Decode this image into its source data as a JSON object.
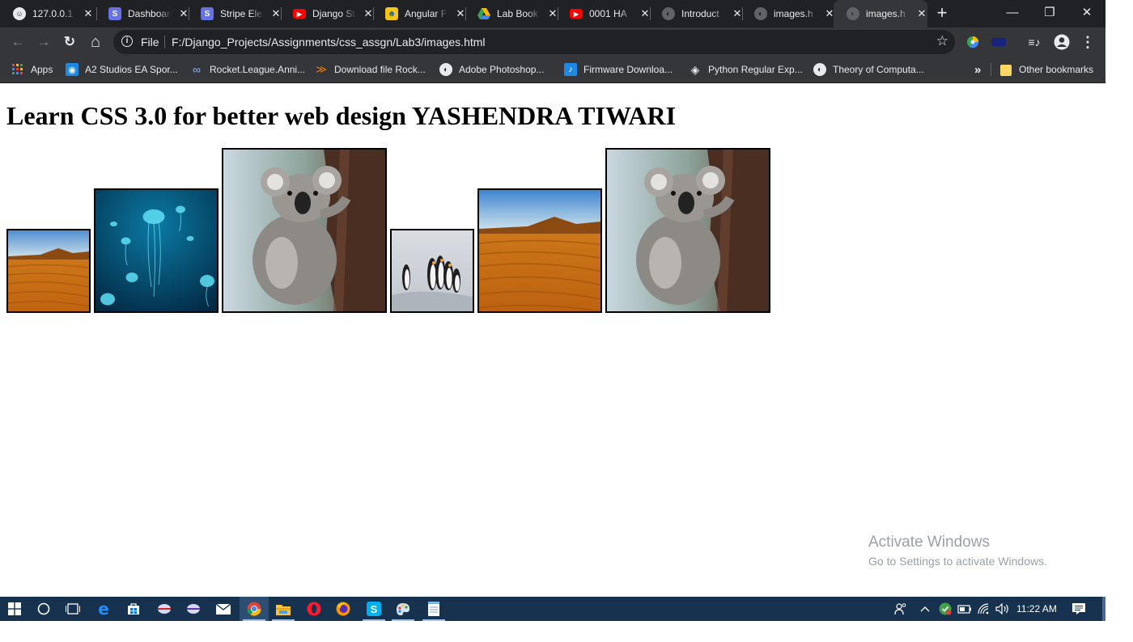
{
  "browser": {
    "tabs": [
      {
        "title": "127.0.0.1",
        "icon": "django-icon",
        "active": false
      },
      {
        "title": "Dashboard",
        "icon": "stripe-icon",
        "active": false
      },
      {
        "title": "Stripe Ele",
        "icon": "stripe-icon",
        "active": false
      },
      {
        "title": "Django St",
        "icon": "youtube-icon",
        "active": false
      },
      {
        "title": "Angular F",
        "icon": "python-icon",
        "active": false
      },
      {
        "title": "Lab Book",
        "icon": "google-drive-icon",
        "active": false
      },
      {
        "title": "0001 HA",
        "icon": "youtube-icon",
        "active": false
      },
      {
        "title": "Introduct",
        "icon": "globe-icon",
        "active": false
      },
      {
        "title": "images.h",
        "icon": "globe-icon",
        "active": false
      },
      {
        "title": "images.h",
        "icon": "globe-icon",
        "active": true
      }
    ],
    "new_tab_label": "+",
    "window_controls": {
      "minimize": "—",
      "restore": "❐",
      "close": "✕"
    },
    "toolbar": {
      "back": "←",
      "forward": "→",
      "reload": "↻",
      "home": "⌂",
      "scheme_label": "File",
      "info_glyph": "i",
      "url": "F:/Django_Projects/Assignments/css_assgn/Lab3/images.html",
      "bookmark_star": "☆"
    },
    "bookmarks": [
      {
        "label": "Apps",
        "icon": "apps-grid-icon"
      },
      {
        "label": "A2 Studios EA Spor...",
        "icon": "a2-studios-icon"
      },
      {
        "label": "Rocket.League.Anni...",
        "icon": "link-icon"
      },
      {
        "label": "Download file Rock...",
        "icon": "download-icon"
      },
      {
        "label": "Adobe Photoshop...",
        "icon": "globe-icon"
      },
      {
        "label": "Firmware Downloa...",
        "icon": "firmware-icon"
      },
      {
        "label": "Python Regular Exp...",
        "icon": "python-regex-icon"
      },
      {
        "label": "Theory of Computa...",
        "icon": "globe-icon"
      }
    ],
    "bookmarks_overflow": "»",
    "other_bookmarks": "Other bookmarks"
  },
  "page": {
    "heading": "Learn CSS 3.0 for better web design YASHENDRA TIWARI",
    "images": [
      {
        "subject": "desert"
      },
      {
        "subject": "jellyfish"
      },
      {
        "subject": "koala"
      },
      {
        "subject": "penguins"
      },
      {
        "subject": "desert"
      },
      {
        "subject": "koala"
      }
    ]
  },
  "watermark": {
    "title": "Activate Windows",
    "subtitle": "Go to Settings to activate Windows."
  },
  "taskbar": {
    "apps": [
      "start",
      "cortana",
      "task-view",
      "edge",
      "store",
      "app-red",
      "app-purple",
      "mail",
      "chrome",
      "file-explorer",
      "opera",
      "firefox",
      "skype",
      "paint",
      "notepad"
    ],
    "clock": "11:22 AM"
  },
  "colors": {
    "tabstrip_bg": "#202124",
    "toolbar_bg": "#35363a",
    "taskbar_bg": "#16324f",
    "text_light": "#e8eaed"
  }
}
